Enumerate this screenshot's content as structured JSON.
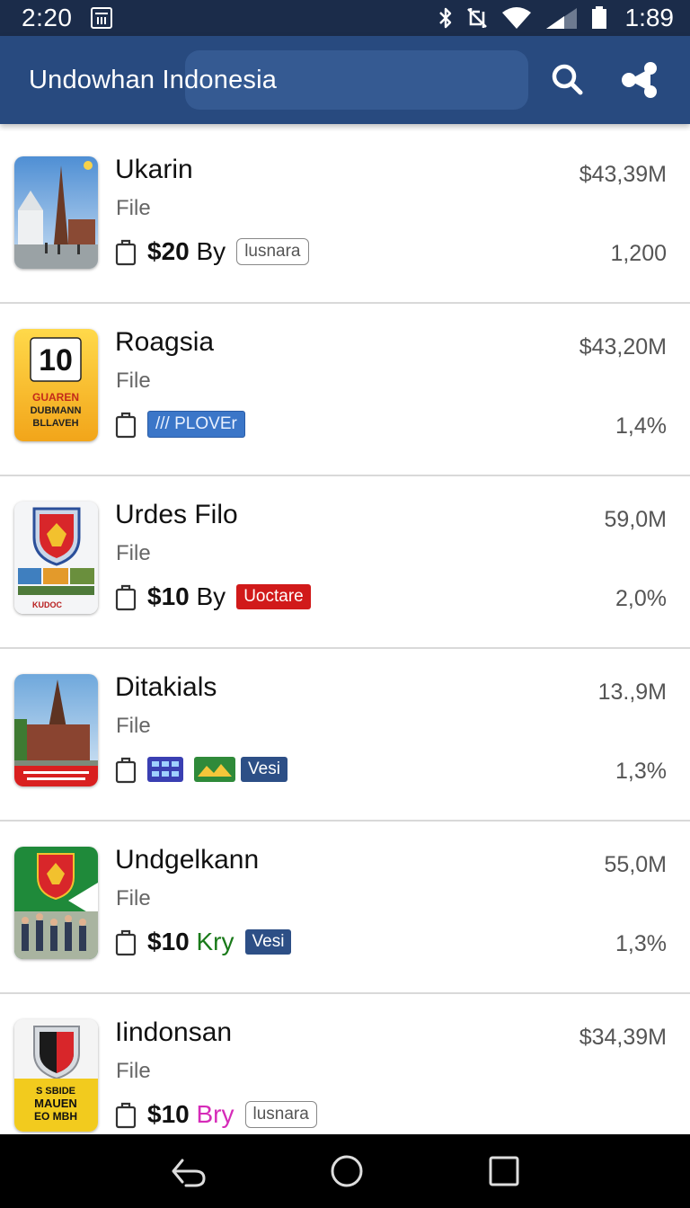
{
  "status": {
    "time": "2:20",
    "clock": "1:89",
    "icons": [
      "calendar-icon",
      "bluetooth-icon",
      "nfc-icon",
      "wifi-icon",
      "signal-icon",
      "battery-icon"
    ]
  },
  "app_bar": {
    "title": "Undowhan Indonesia",
    "actions": [
      "search-icon",
      "share-icon"
    ]
  },
  "items": [
    {
      "title": "Ukarin",
      "subtitle": "File",
      "price": "$20",
      "unit": "By",
      "unit_color": "#111111",
      "tag": "lusnara",
      "amount": "$43,39M",
      "stat": "1,200"
    },
    {
      "title": "Roagsia",
      "subtitle": "File",
      "tag": "PLOVEr",
      "amount": "$43,20M",
      "stat": "1,4%",
      "thumb_text": {
        "number": "10",
        "line1": "GUAREN",
        "line2": "DUBMANN",
        "line3": "BLLAVEH"
      }
    },
    {
      "title": "Urdes Filo",
      "subtitle": "File",
      "price": "$10",
      "unit": "By",
      "unit_color": "#111111",
      "tag": "Uoctare",
      "amount": "59,0M",
      "stat": "2,0%",
      "thumb_text": {
        "caption": "KUDOC"
      }
    },
    {
      "title": "Ditakials",
      "subtitle": "File",
      "tag": "Vesi",
      "amount": "13.,9M",
      "stat": "1,3%"
    },
    {
      "title": "Undgelkann",
      "subtitle": "File",
      "price": "$10",
      "unit": "Kry",
      "unit_color": "#1a7a1a",
      "tag": "Vesi",
      "amount": "55,0M",
      "stat": "1,3%"
    },
    {
      "title": "Iindonsan",
      "subtitle": "File",
      "price": "$10",
      "unit": "Bry",
      "unit_color": "#d62bb8",
      "tag": "lusnara",
      "amount": "$34,39M",
      "stat": "",
      "thumb_text": {
        "line1": "S SBIDE",
        "line2": "MAUEN",
        "line3": "EO MBH"
      }
    }
  ],
  "nav": [
    "back-icon",
    "home-icon",
    "recents-icon"
  ],
  "colors": {
    "status_bar": "#1b2c4a",
    "app_bar": "#284a7f",
    "divider": "#d9d9d9"
  }
}
